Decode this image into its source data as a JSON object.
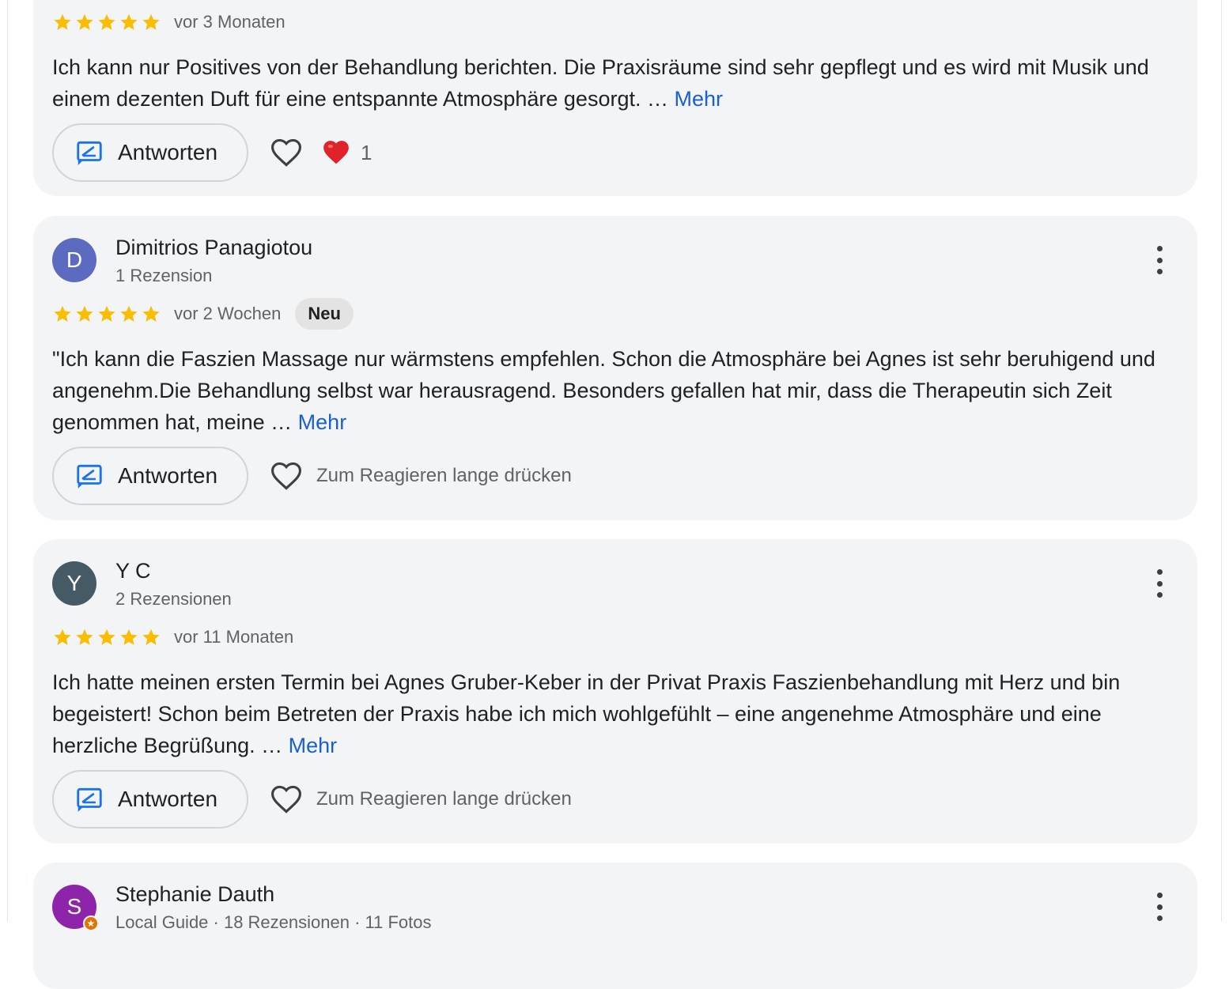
{
  "reviews": [
    {
      "stars": 5,
      "time": "vor 3 Monaten",
      "text": "Ich kann nur Positives von der Behandlung berichten. Die Praxisräume sind sehr gepflegt und es wird mit Musik und einem dezenten Duft für eine entspannte Atmosphäre gesorgt. … ",
      "more": "Mehr",
      "reply_label": "Antworten",
      "reaction_count": "1"
    },
    {
      "author": "Dimitrios Panagiotou",
      "avatar_letter": "D",
      "avatar_color": "#5c6bc0",
      "subline": "1 Rezension",
      "stars": 5,
      "time": "vor 2 Wochen",
      "badge": "Neu",
      "text": "\"Ich kann die Faszien Massage nur wärmstens empfehlen. Schon die Atmosphäre bei Agnes ist sehr beruhigend und angenehm.Die Behandlung selbst war herausragend. Besonders gefallen hat mir, dass die Therapeutin sich Zeit genommen hat, meine … ",
      "more": "Mehr",
      "reply_label": "Antworten",
      "react_hint": "Zum Reagieren lange drücken"
    },
    {
      "author": "Y C",
      "avatar_letter": "Y",
      "avatar_color": "#455a64",
      "subline": "2 Rezensionen",
      "stars": 5,
      "time": "vor 11 Monaten",
      "text": "Ich hatte meinen ersten Termin bei Agnes Gruber-Keber in der Privat Praxis Faszienbehandlung mit Herz und bin begeistert! Schon beim Betreten der Praxis habe ich mich wohlgefühlt – eine angenehme Atmosphäre und eine herzliche Begrüßung. … ",
      "more": "Mehr",
      "reply_label": "Antworten",
      "react_hint": "Zum Reagieren lange drücken"
    },
    {
      "author": "Stephanie Dauth",
      "avatar_letter": "S",
      "avatar_color": "#8e24aa",
      "subline": "Local Guide · 18 Rezensionen · 11 Fotos"
    }
  ],
  "colors": {
    "star": "#fbbc04",
    "link": "#1a5fd0",
    "reply_icon": "#1a73e8",
    "heart_filled": "#e0222b",
    "card_bg": "#f3f4f6"
  },
  "icons": {
    "reply": "reply-icon",
    "like": "heart-outline-icon",
    "reaction": "red-heart-icon",
    "more": "more-vert-icon",
    "rating": "star-icon"
  }
}
